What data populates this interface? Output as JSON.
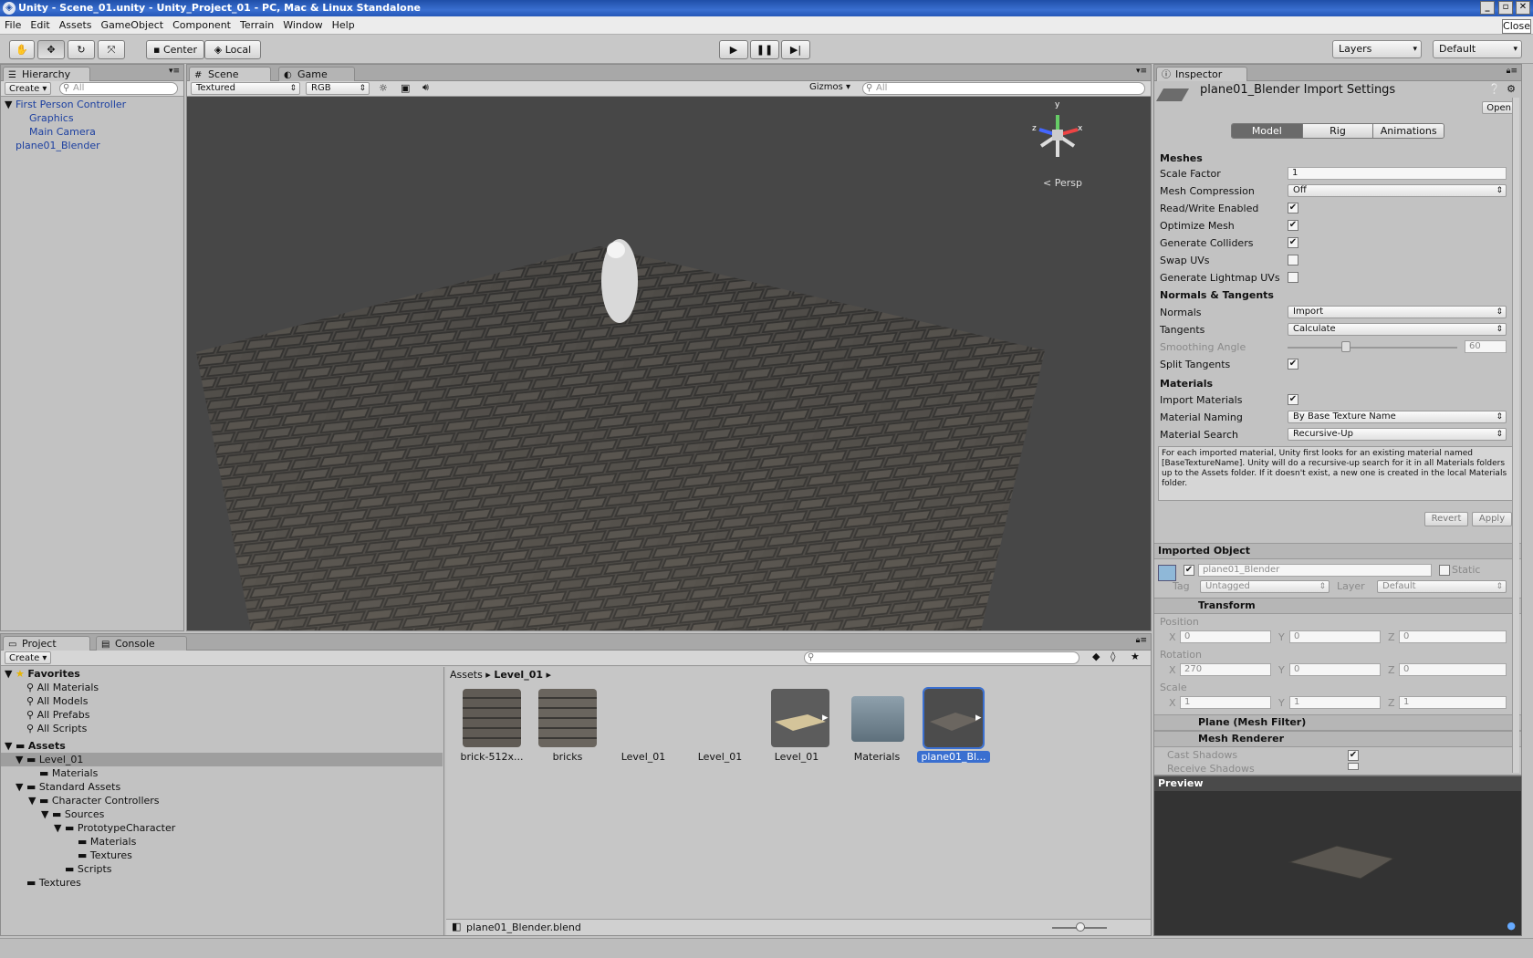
{
  "window": {
    "title": "Unity - Scene_01.unity - Unity_Project_01 - PC, Mac & Linux Standalone",
    "close_label": "Close"
  },
  "menu": [
    "File",
    "Edit",
    "Assets",
    "GameObject",
    "Component",
    "Terrain",
    "Window",
    "Help"
  ],
  "toolbar": {
    "pivot": "Center",
    "space": "Local",
    "layers": "Layers",
    "layout": "Default"
  },
  "hierarchy": {
    "tab": "Hierarchy",
    "create": "Create",
    "search_placeholder": "All",
    "items": [
      "First Person Controller",
      "Graphics",
      "Main Camera",
      "plane01_Blender"
    ]
  },
  "scene": {
    "tab_scene": "Scene",
    "tab_game": "Game",
    "render_mode": "Textured",
    "color_mode": "RGB",
    "gizmos": "Gizmos",
    "search_placeholder": "All",
    "gizmo_y": "y",
    "gizmo_x": "x",
    "gizmo_z": "z",
    "persp": "Persp"
  },
  "project": {
    "tab_project": "Project",
    "tab_console": "Console",
    "create": "Create",
    "favorites": {
      "label": "Favorites",
      "items": [
        "All Materials",
        "All Models",
        "All Prefabs",
        "All Scripts"
      ]
    },
    "assets_label": "Assets",
    "tree": [
      "Level_01",
      "Materials",
      "Standard Assets",
      "Character Controllers",
      "Sources",
      "PrototypeCharacter",
      "Materials",
      "Textures",
      "Scripts",
      "Textures"
    ],
    "breadcrumb": [
      "Assets",
      "Level_01"
    ],
    "grid": [
      "brick-512x...",
      "bricks",
      "Level_01",
      "Level_01",
      "Level_01",
      "Materials",
      "plane01_Bl..."
    ],
    "status_file": "plane01_Blender.blend"
  },
  "inspector": {
    "tab": "Inspector",
    "title": "plane01_Blender Import Settings",
    "open": "Open",
    "tabs": [
      "Model",
      "Rig",
      "Animations"
    ],
    "meshes": {
      "label": "Meshes",
      "scale_factor_label": "Scale Factor",
      "scale_factor": "1",
      "mesh_compression_label": "Mesh Compression",
      "mesh_compression": "Off",
      "read_write_label": "Read/Write Enabled",
      "optimize_label": "Optimize Mesh",
      "colliders_label": "Generate Colliders",
      "swap_uvs_label": "Swap UVs",
      "lightmap_label": "Generate Lightmap UVs"
    },
    "normals": {
      "label": "Normals & Tangents",
      "normals_label": "Normals",
      "normals": "Import",
      "tangents_label": "Tangents",
      "tangents": "Calculate",
      "smoothing_label": "Smoothing Angle",
      "smoothing": "60",
      "split_label": "Split Tangents"
    },
    "materials": {
      "label": "Materials",
      "import_label": "Import Materials",
      "naming_label": "Material Naming",
      "naming": "By Base Texture Name",
      "search_label": "Material Search",
      "search": "Recursive-Up",
      "help": "For each imported material, Unity first looks for an existing material named [BaseTextureName]. Unity will do a recursive-up search for it in all Materials folders up to the Assets folder. If it doesn't exist, a new one is created in the local Materials folder."
    },
    "revert": "Revert",
    "apply": "Apply",
    "imported": {
      "label": "Imported Object",
      "name": "plane01_Blender",
      "static": "Static",
      "tag_label": "Tag",
      "tag": "Untagged",
      "layer_label": "Layer",
      "layer": "Default"
    },
    "transform": {
      "label": "Transform",
      "position_label": "Position",
      "position": [
        "0",
        "0",
        "0"
      ],
      "rotation_label": "Rotation",
      "rotation": [
        "270",
        "0",
        "0"
      ],
      "scale_label": "Scale",
      "scale": [
        "1",
        "1",
        "1"
      ],
      "axis": [
        "X",
        "Y",
        "Z"
      ]
    },
    "mesh_filter": "Plane (Mesh Filter)",
    "mesh_renderer": "Mesh Renderer",
    "cast_shadows": "Cast Shadows",
    "receive_shadows": "Receive Shadows",
    "preview": "Preview"
  }
}
